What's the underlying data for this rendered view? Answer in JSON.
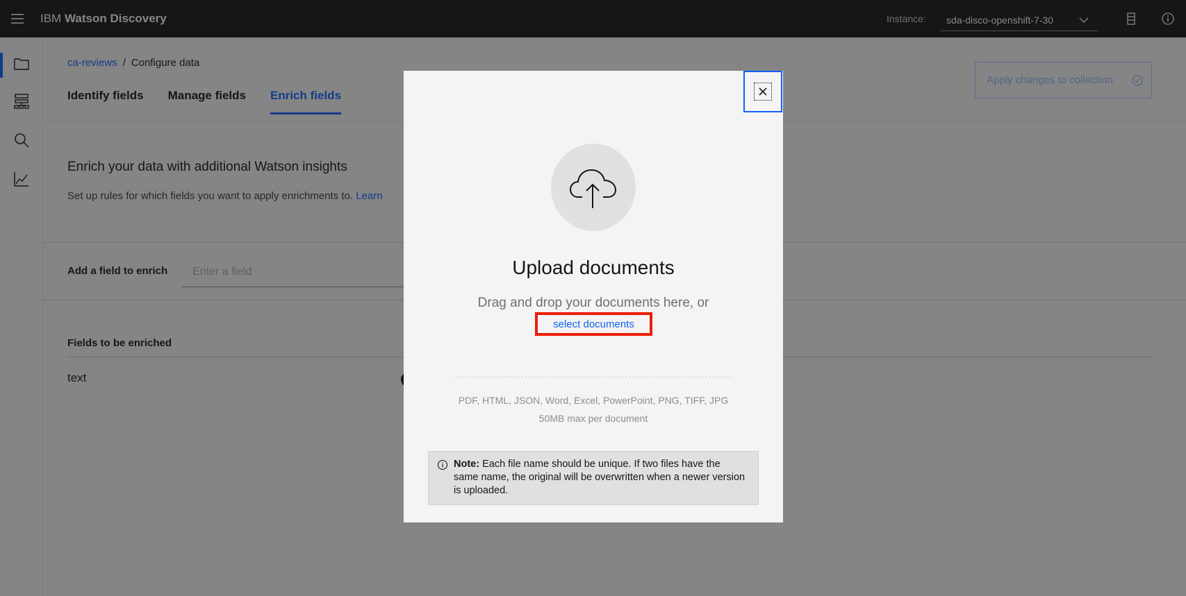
{
  "header": {
    "brand_prefix": "IBM",
    "brand_name": "Watson Discovery",
    "instance_label": "Instance:",
    "instance_value": "sda-disco-openshift-7-30"
  },
  "breadcrumb": {
    "collection": "ca-reviews",
    "separator": "/",
    "current": "Configure data"
  },
  "apply_button": "Apply changes to collection",
  "tabs": [
    {
      "label": "Identify fields",
      "active": false
    },
    {
      "label": "Manage fields",
      "active": false
    },
    {
      "label": "Enrich fields",
      "active": true
    }
  ],
  "enrich": {
    "title": "Enrich your data with additional Watson insights",
    "description": "Set up rules for which fields you want to apply enrichments to.",
    "learn_link": "Learn",
    "add_field_label": "Add a field to enrich",
    "add_field_placeholder": "Enter a field",
    "fields_header": "Fields to be enriched",
    "fields": [
      "text"
    ]
  },
  "modal": {
    "title": "Upload documents",
    "drag_text": "Drag and drop your documents here, or",
    "select_link": "select documents",
    "formats": "PDF, HTML, JSON, Word, Excel, PowerPoint, PNG, TIFF, JPG",
    "max_size": "50MB max per document",
    "note_label": "Note:",
    "note_text": "Each file name should be unique. If two files have the same name, the original will be overwritten when a newer version is uploaded."
  },
  "icons": {
    "menu": "hamburger-menu-icon",
    "docs": "document-icon",
    "info": "information-icon",
    "close": "close-icon",
    "upload": "cloud-upload-icon"
  },
  "colors": {
    "accent": "#0f62fe",
    "header_bg": "#161616",
    "highlight": "#ee1e05"
  }
}
